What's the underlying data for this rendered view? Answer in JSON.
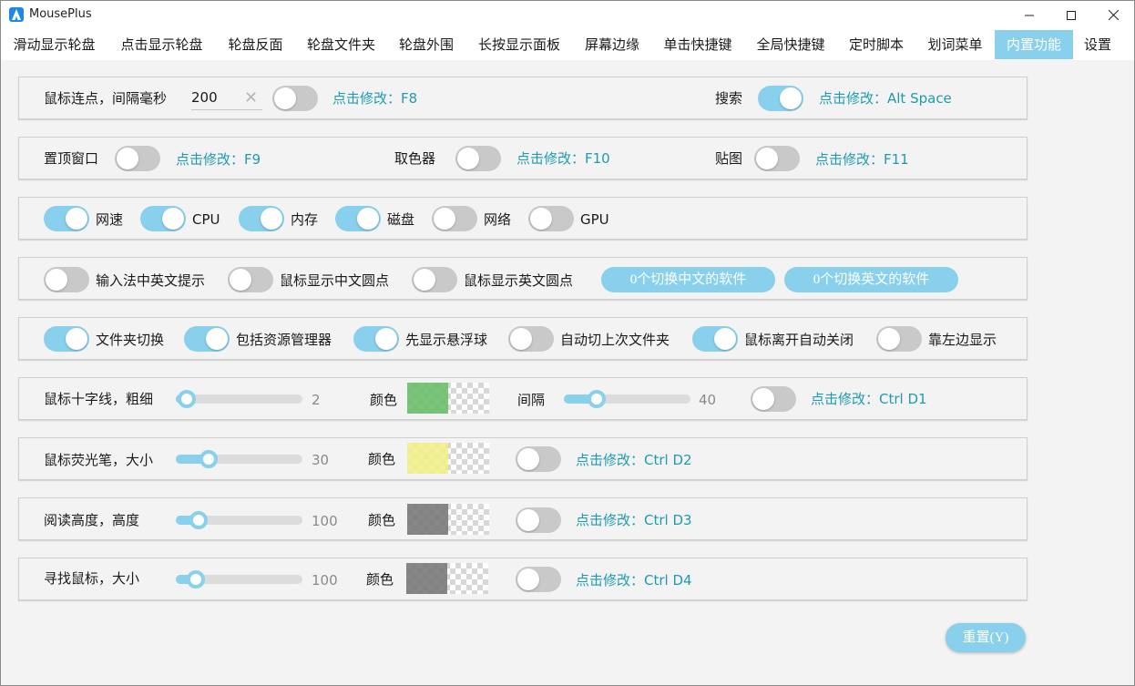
{
  "window": {
    "title": "MousePlus"
  },
  "tabs": [
    {
      "label": "滑动显示轮盘"
    },
    {
      "label": "点击显示轮盘"
    },
    {
      "label": "轮盘反面"
    },
    {
      "label": "轮盘文件夹"
    },
    {
      "label": "轮盘外围"
    },
    {
      "label": "长按显示面板"
    },
    {
      "label": "屏幕边缘"
    },
    {
      "label": "单击快捷键"
    },
    {
      "label": "全局快捷键"
    },
    {
      "label": "定时脚本"
    },
    {
      "label": "划词菜单"
    },
    {
      "label": "内置功能",
      "active": true
    },
    {
      "label": "设置"
    }
  ],
  "row1": {
    "click_label": "鼠标连点，间隔毫秒",
    "interval_value": "200",
    "click_toggle": false,
    "click_hotkey": "点击修改：F8",
    "search_label": "搜索",
    "search_toggle": true,
    "search_hotkey": "点击修改：Alt Space"
  },
  "row2": {
    "pin_label": "置顶窗口",
    "pin_toggle": false,
    "pin_hotkey": "点击修改：F9",
    "picker_label": "取色器",
    "picker_toggle": false,
    "picker_hotkey": "点击修改：F10",
    "sticker_label": "贴图",
    "sticker_toggle": false,
    "sticker_hotkey": "点击修改：F11"
  },
  "row3": {
    "items": [
      {
        "label": "网速",
        "on": true
      },
      {
        "label": "CPU",
        "on": true
      },
      {
        "label": "内存",
        "on": true
      },
      {
        "label": "磁盘",
        "on": true
      },
      {
        "label": "网络",
        "on": false
      },
      {
        "label": "GPU",
        "on": false
      }
    ]
  },
  "row4": {
    "items": [
      {
        "label": "输入法中英文提示",
        "on": false
      },
      {
        "label": "鼠标显示中文圆点",
        "on": false
      },
      {
        "label": "鼠标显示英文圆点",
        "on": false
      }
    ],
    "btn_cn": "0个切换中文的软件",
    "btn_en": "0个切换英文的软件"
  },
  "row5": {
    "items": [
      {
        "label": "文件夹切换",
        "on": true
      },
      {
        "label": "包括资源管理器",
        "on": true
      },
      {
        "label": "先显示悬浮球",
        "on": true
      },
      {
        "label": "自动切上次文件夹",
        "on": false
      },
      {
        "label": "鼠标离开自动关闭",
        "on": true
      },
      {
        "label": "靠左边显示",
        "on": false
      }
    ]
  },
  "crosshair": {
    "label": "鼠标十字线，粗细",
    "value": "2",
    "level": 0.02,
    "color_label": "颜色",
    "color": "#6cbf6c",
    "gap_label": "间隔",
    "gap_value": "40",
    "gap_level": 0.22,
    "toggle": false,
    "hotkey": "点击修改：Ctrl D1"
  },
  "highlighter": {
    "label": "鼠标荧光笔，大小",
    "value": "30",
    "level": 0.22,
    "color_label": "颜色",
    "color": "#f2f08a",
    "toggle": false,
    "hotkey": "点击修改：Ctrl D2"
  },
  "reading": {
    "label": "阅读高度，高度",
    "value": "100",
    "level": 0.13,
    "color_label": "颜色",
    "color": "#7a7a7a",
    "toggle": false,
    "hotkey": "点击修改：Ctrl D3"
  },
  "findmouse": {
    "label": "寻找鼠标，大小",
    "value": "100",
    "level": 0.1,
    "color_label": "颜色",
    "color": "#7a7a7a",
    "toggle": false,
    "hotkey": "点击修改：Ctrl D4"
  },
  "footer": {
    "reset_label": "重置(Y)"
  },
  "colors": {
    "accent": "#89d0ec",
    "hotkey_text": "#1f9bb0",
    "toggle_off": "#c9c9c9"
  },
  "icons": [
    "app-logo-icon",
    "minimize-icon",
    "maximize-icon",
    "close-icon",
    "clear-icon"
  ]
}
